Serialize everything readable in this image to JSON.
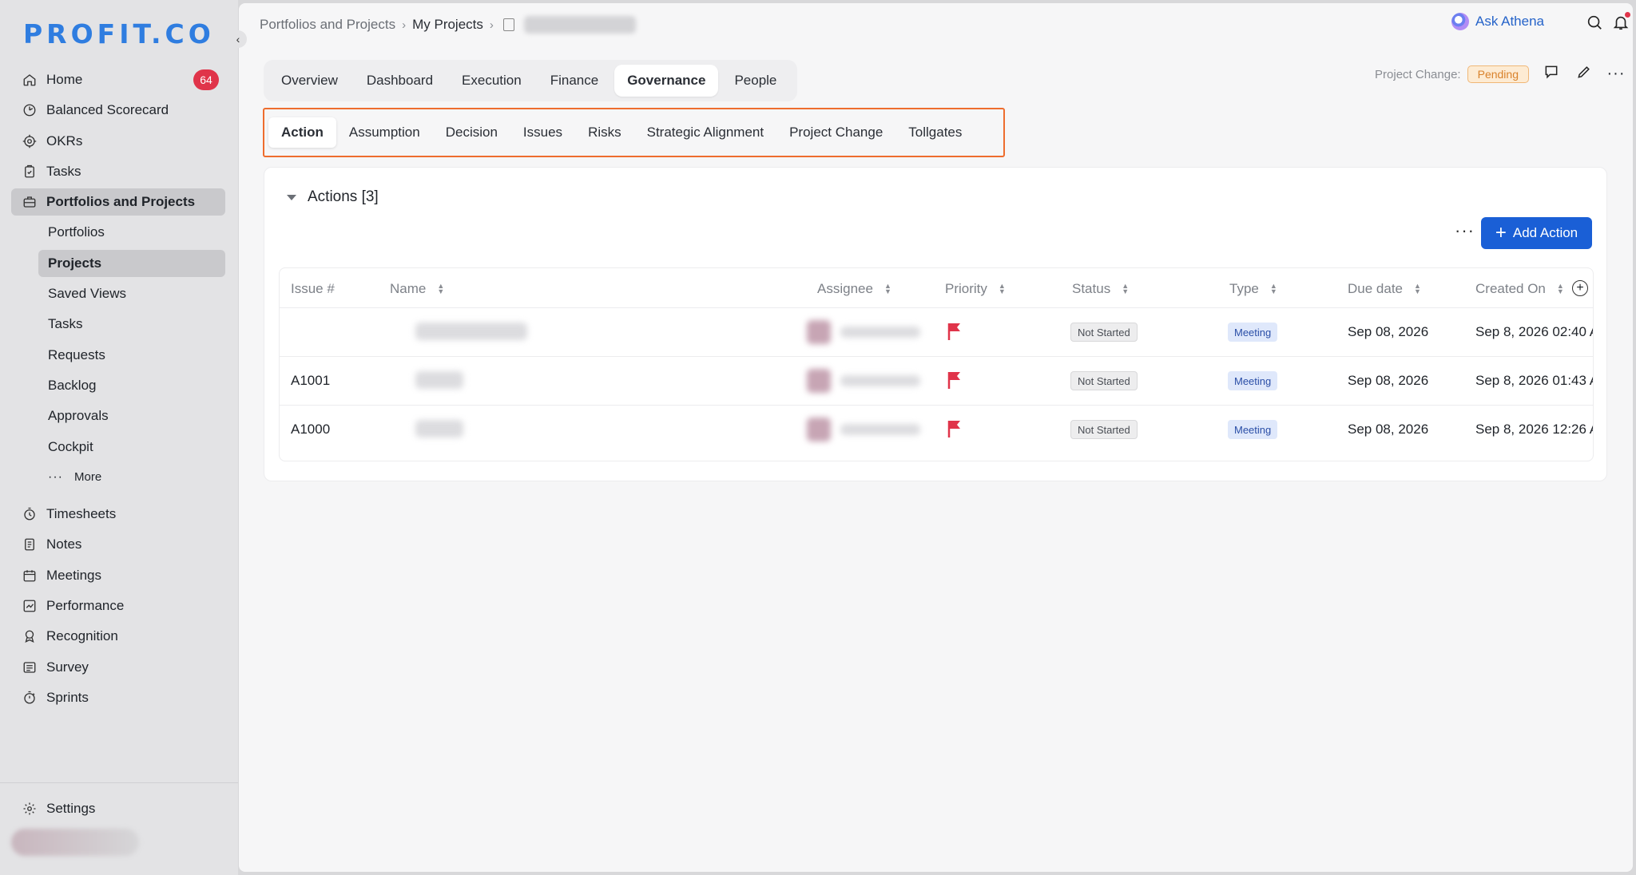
{
  "app": {
    "logo": "PROFIT.CO"
  },
  "sidebar": {
    "items": [
      {
        "label": "Home",
        "icon": "home-icon",
        "badge": "64"
      },
      {
        "label": "Balanced Scorecard",
        "icon": "scorecard-icon"
      },
      {
        "label": "OKRs",
        "icon": "target-icon"
      },
      {
        "label": "Tasks",
        "icon": "tasks-icon"
      },
      {
        "label": "Portfolios and Projects",
        "icon": "briefcase-icon",
        "active": true
      }
    ],
    "subitems": [
      "Portfolios",
      "Projects",
      "Saved Views",
      "Tasks",
      "Requests",
      "Backlog",
      "Approvals",
      "Cockpit"
    ],
    "active_subitem": "Projects",
    "more_label": "More",
    "items2": [
      {
        "label": "Timesheets",
        "icon": "stopwatch-icon"
      },
      {
        "label": "Notes",
        "icon": "notes-icon"
      },
      {
        "label": "Meetings",
        "icon": "calendar-icon"
      },
      {
        "label": "Performance",
        "icon": "chart-icon"
      },
      {
        "label": "Recognition",
        "icon": "award-icon"
      },
      {
        "label": "Survey",
        "icon": "survey-icon"
      },
      {
        "label": "Sprints",
        "icon": "sprint-icon"
      }
    ],
    "settings_label": "Settings"
  },
  "header": {
    "breadcrumb": [
      "Portfolios and Projects",
      "My Projects"
    ],
    "ask_label": "Ask Athena",
    "project_change_label": "Project Change:",
    "project_change_status": "Pending"
  },
  "tabs": [
    "Overview",
    "Dashboard",
    "Execution",
    "Finance",
    "Governance",
    "People"
  ],
  "active_tab": "Governance",
  "subtabs": [
    "Action",
    "Assumption",
    "Decision",
    "Issues",
    "Risks",
    "Strategic Alignment",
    "Project Change",
    "Tollgates"
  ],
  "active_subtab": "Action",
  "section": {
    "title": "Actions [3]",
    "add_button": "Add Action"
  },
  "table": {
    "columns": [
      "Issue #",
      "Name",
      "Assignee",
      "Priority",
      "Status",
      "Type",
      "Due date",
      "Created On"
    ],
    "rows": [
      {
        "issue": "",
        "status": "Not Started",
        "type": "Meeting",
        "due": "Sep 08, 2026",
        "created": "Sep 8, 2026 02:40 A"
      },
      {
        "issue": "A1001",
        "status": "Not Started",
        "type": "Meeting",
        "due": "Sep 08, 2026",
        "created": "Sep 8, 2026 01:43 A"
      },
      {
        "issue": "A1000",
        "status": "Not Started",
        "type": "Meeting",
        "due": "Sep 08, 2026",
        "created": "Sep 8, 2026 12:26 A"
      }
    ]
  },
  "colors": {
    "accent": "#1a5fd6",
    "badge": "#e0344a",
    "highlight_border": "#ee6d2e",
    "flag": "#e0344a",
    "pending": "#d9822b"
  }
}
